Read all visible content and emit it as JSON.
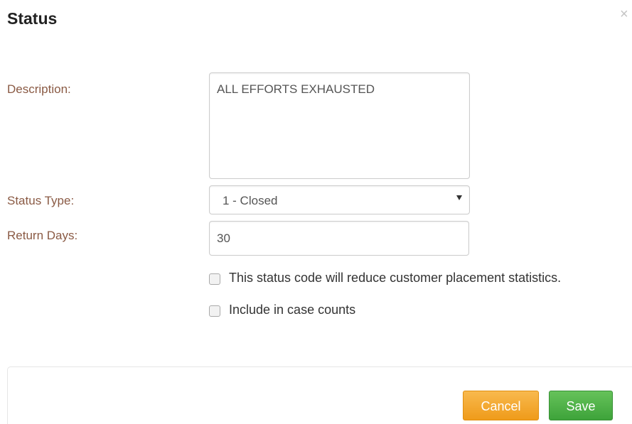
{
  "dialog": {
    "title": "Status",
    "close_symbol": "×"
  },
  "fields": {
    "description_label": "Description:",
    "description_value": "ALL EFFORTS EXHAUSTED",
    "status_type_label": "Status Type:",
    "status_type_value": "1 - Closed",
    "return_days_label": "Return Days:",
    "return_days_value": "30"
  },
  "checkboxes": {
    "reduce_stats_label": "This status code will reduce customer placement statistics.",
    "reduce_stats_checked": false,
    "include_counts_label": "Include in case counts",
    "include_counts_checked": false
  },
  "buttons": {
    "cancel_label": "Cancel",
    "save_label": "Save"
  },
  "colors": {
    "label_text": "#8a5a44",
    "cancel_button": "#f0a125",
    "save_button": "#4cad45"
  }
}
